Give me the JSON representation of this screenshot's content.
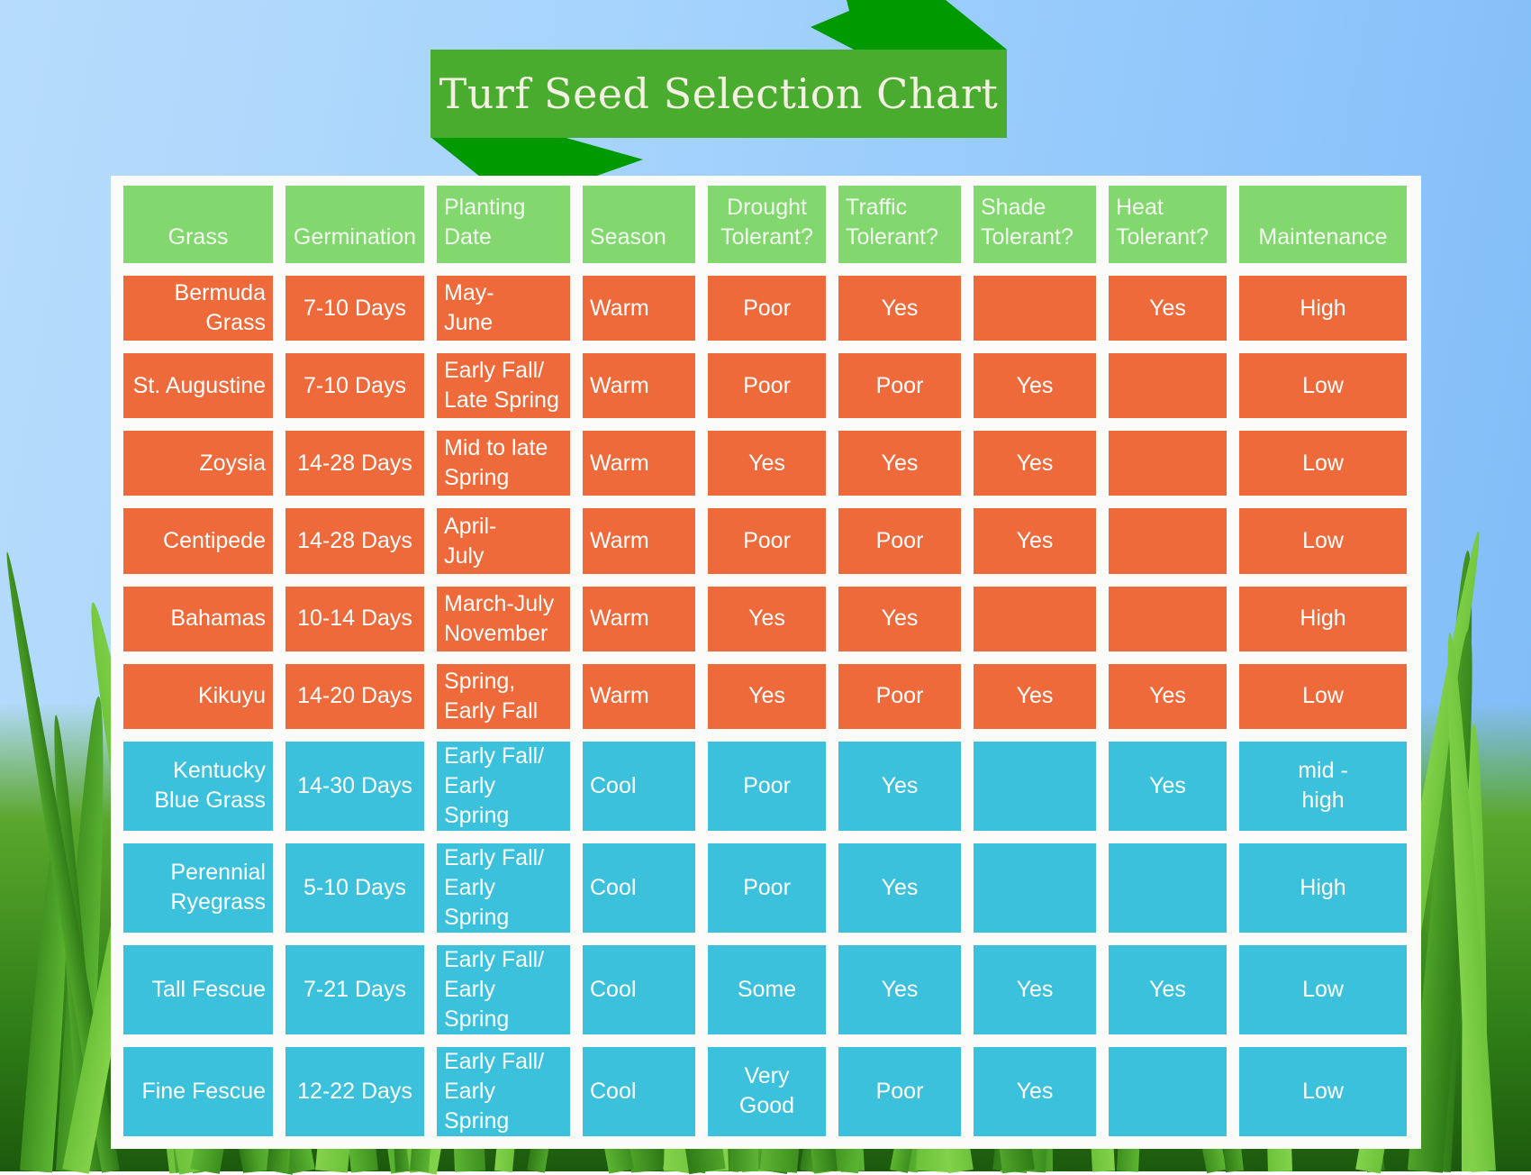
{
  "title": "Turf Seed Selection Chart",
  "colors": {
    "banner": "#49ac2f",
    "banner_fold": "#009900",
    "header": "#82d86e",
    "warm": "#ee6a3a",
    "cool": "#3bc1db",
    "panel": "#fbfbf9"
  },
  "columns": [
    "Grass",
    "Germination",
    "Planting\nDate",
    "Season",
    "Drought\nTolerant?",
    "Traffic\nTolerant?",
    "Shade\nTolerant?",
    "Heat\nTolerant?",
    "Maintenance"
  ],
  "rows": [
    {
      "grass": "Bermuda\nGrass",
      "germination": "7-10 Days",
      "planting": "May-\nJune",
      "season": "Warm",
      "drought": "Poor",
      "traffic": "Yes",
      "shade": "",
      "heat": "Yes",
      "maintenance": "High"
    },
    {
      "grass": "St. Augustine",
      "germination": "7-10 Days",
      "planting": "Early Fall/\nLate Spring",
      "season": "Warm",
      "drought": "Poor",
      "traffic": "Poor",
      "shade": "Yes",
      "heat": "",
      "maintenance": "Low"
    },
    {
      "grass": "Zoysia",
      "germination": "14-28 Days",
      "planting": "Mid to late\nSpring",
      "season": "Warm",
      "drought": "Yes",
      "traffic": "Yes",
      "shade": "Yes",
      "heat": "",
      "maintenance": "Low"
    },
    {
      "grass": "Centipede",
      "germination": "14-28 Days",
      "planting": "April-\nJuly",
      "season": "Warm",
      "drought": "Poor",
      "traffic": "Poor",
      "shade": "Yes",
      "heat": "",
      "maintenance": "Low"
    },
    {
      "grass": "Bahamas",
      "germination": "10-14 Days",
      "planting": "March-July\nNovember",
      "season": "Warm",
      "drought": "Yes",
      "traffic": "Yes",
      "shade": "",
      "heat": "",
      "maintenance": "High"
    },
    {
      "grass": "Kikuyu",
      "germination": "14-20 Days",
      "planting": "Spring,\nEarly Fall",
      "season": "Warm",
      "drought": "Yes",
      "traffic": "Poor",
      "shade": "Yes",
      "heat": "Yes",
      "maintenance": "Low"
    },
    {
      "grass": "Kentucky\nBlue Grass",
      "germination": "14-30 Days",
      "planting": "Early Fall/\nEarly Spring",
      "season": "Cool",
      "drought": "Poor",
      "traffic": "Yes",
      "shade": "",
      "heat": "Yes",
      "maintenance": "mid -\nhigh"
    },
    {
      "grass": "Perennial\nRyegrass",
      "germination": "5-10 Days",
      "planting": "Early Fall/\nEarly Spring",
      "season": "Cool",
      "drought": "Poor",
      "traffic": "Yes",
      "shade": "",
      "heat": "",
      "maintenance": "High"
    },
    {
      "grass": "Tall Fescue",
      "germination": "7-21 Days",
      "planting": "Early Fall/\nEarly Spring",
      "season": "Cool",
      "drought": "Some",
      "traffic": "Yes",
      "shade": "Yes",
      "heat": "Yes",
      "maintenance": "Low"
    },
    {
      "grass": "Fine Fescue",
      "germination": "12-22 Days",
      "planting": "Early Fall/\nEarly Spring",
      "season": "Cool",
      "drought": "Very\nGood",
      "traffic": "Poor",
      "shade": "Yes",
      "heat": "",
      "maintenance": "Low"
    }
  ]
}
